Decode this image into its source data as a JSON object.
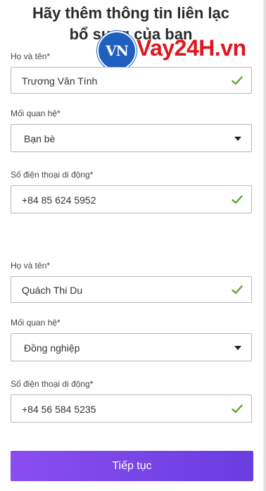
{
  "header": {
    "title_line1": "Hãy thêm thông tin liên lạc",
    "title_line2": "bổ sung của bạn"
  },
  "watermark": {
    "badge_text": "VN",
    "brand_text": "Vay24H.vn"
  },
  "contact1": {
    "name_label": "Họ và tên*",
    "name_value": "Trương Văn Tính",
    "relation_label": "Mối quan hệ*",
    "relation_value": "Bạn bè",
    "phone_label": "Số điện thoại di động*",
    "phone_value": "+84 85 624 5952"
  },
  "contact2": {
    "name_label": "Họ và tên*",
    "name_value": "Quách Thi Du",
    "relation_label": "Mối quan hệ*",
    "relation_value": "Đồng nghiệp",
    "phone_label": "Số điện thoại di động*",
    "phone_value": "+84 56 584 5235"
  },
  "submit_label": "Tiếp tục",
  "colors": {
    "accent": "#7b45ea",
    "check": "#5aa832",
    "brand_red": "#e0161f",
    "brand_blue": "#1f5fbf"
  }
}
